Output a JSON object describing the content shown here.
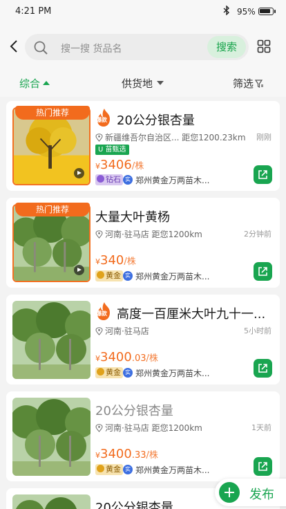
{
  "status_bar": {
    "time": "4:21 PM",
    "battery": "95%"
  },
  "search": {
    "placeholder": "搜一搜 货品名",
    "button": "搜索"
  },
  "filters": {
    "sort": "综合",
    "origin": "供货地",
    "filter": "筛选"
  },
  "listings": [
    {
      "hot_tag": "热门推荐",
      "title": "20公分银杏量",
      "location": "新疆维吾尔自治区...",
      "distance": "距您1200.23km",
      "time": "刚刚",
      "badge": "U 苗甄选",
      "price_int": "3406",
      "price_dec": "",
      "unit": "/株",
      "grade": "钻石",
      "company": "郑州黄金万两苗木..."
    },
    {
      "hot_tag": "热门推荐",
      "title": "大量大叶黄杨",
      "location": "河南·驻马店",
      "distance": "距您1200km",
      "time": "2分钟前",
      "price_int": "340",
      "price_dec": "",
      "unit": "/株",
      "grade": "黄金",
      "company": "郑州黄金万两苗木..."
    },
    {
      "title": "高度一百厘米大叶九十一...",
      "location": "河南·驻马店",
      "distance": "",
      "time": "5小时前",
      "price_int": "3400",
      "price_dec": ".03",
      "unit": "/株",
      "grade": "黄金",
      "company": "郑州黄金万两苗木..."
    },
    {
      "title": "20公分银杏量",
      "location": "河南·驻马店",
      "distance": "距您1200km",
      "time": "1天前",
      "price_int": "3400",
      "price_dec": ".33",
      "unit": "/株",
      "grade": "黄金",
      "company": "郑州黄金万两苗木..."
    },
    {
      "title": "20公分银杏量"
    }
  ],
  "flame_label": "爆款",
  "currency": "¥",
  "verified_mark": "实",
  "publish": "发布",
  "colors": {
    "accent": "#19a550",
    "price": "#f26b1d",
    "hot": "#f26b1d"
  }
}
